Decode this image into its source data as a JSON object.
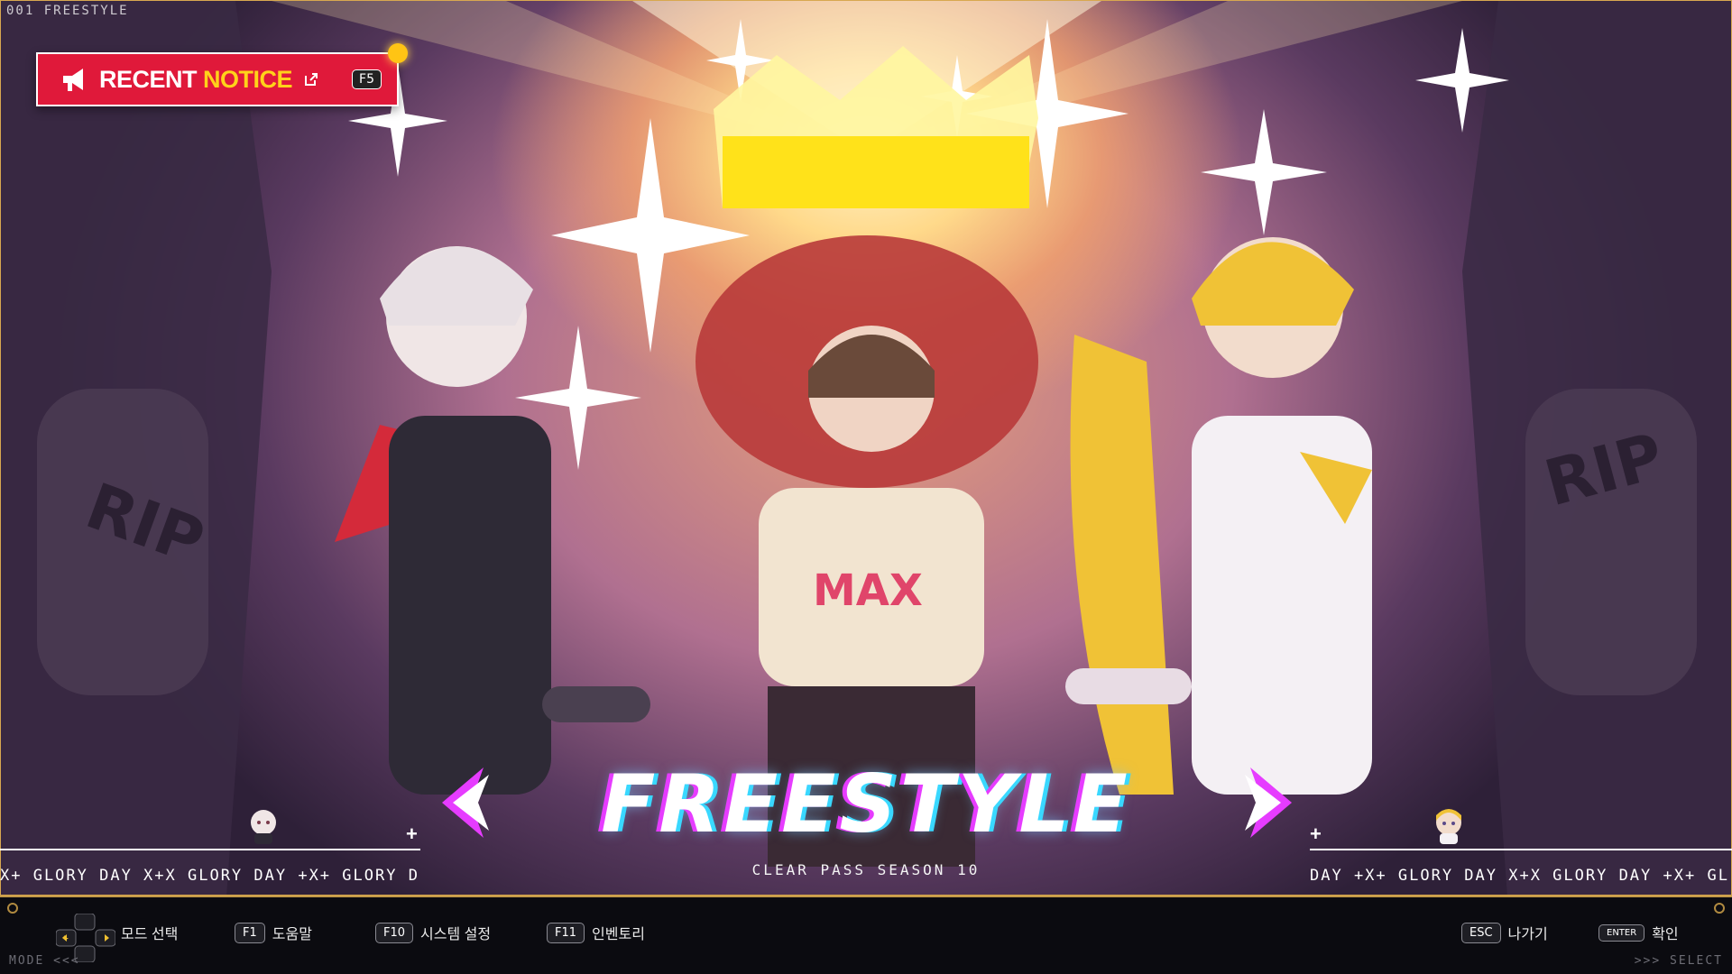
{
  "scene": {
    "label": "001 FREESTYLE"
  },
  "notice": {
    "word1": "RECENT",
    "word2": "NOTICE",
    "hotkey": "F5",
    "colors": {
      "background": "#e0193a",
      "highlight": "#ffd21a",
      "badge": "#ffc414"
    }
  },
  "carousel": {
    "mode_title": "FREESTYLE",
    "subtitle": "CLEAR PASS SEASON 10",
    "ticker_left": "X+ GLORY DAY X+X GLORY DAY +X+ GLORY D",
    "ticker_right": "DAY +X+ GLORY DAY X+X GLORY DAY +X+ GL",
    "glitch_colors": {
      "magenta": "#e63cff",
      "cyan": "#39d8ff"
    }
  },
  "footer": {
    "mode_select_label": "모드 선택",
    "help": {
      "key": "F1",
      "label": "도움말"
    },
    "settings": {
      "key": "F10",
      "label": "시스템 설정"
    },
    "inventory": {
      "key": "F11",
      "label": "인벤토리"
    },
    "exit": {
      "key": "ESC",
      "label": "나가기"
    },
    "confirm": {
      "key": "ENTER",
      "label": "확인"
    },
    "mode_hint": "MODE <<<",
    "select_hint": ">>> SELECT"
  }
}
